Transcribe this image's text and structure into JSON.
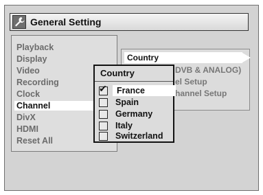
{
  "window": {
    "title": "General Setting",
    "icon": "wrench-icon"
  },
  "leftmenu": {
    "items": [
      "Playback",
      "Display",
      "Video",
      "Recording",
      "Clock",
      "Channel",
      "DivX",
      "HDMI",
      "Reset All"
    ],
    "selected": "Channel"
  },
  "rightmenu": {
    "items": [
      "Country",
      "DVB & ANALOG)",
      "el Setup",
      "hannel Setup"
    ],
    "highlighted": "Country"
  },
  "popup": {
    "title": "Country",
    "options": [
      {
        "label": "France",
        "checked": true
      },
      {
        "label": "Spain",
        "checked": false
      },
      {
        "label": "Germany",
        "checked": false
      },
      {
        "label": "Italy",
        "checked": false
      },
      {
        "label": "Switzerland",
        "checked": false
      }
    ]
  },
  "colors": {
    "background": "#d3d3d3",
    "selected": "#ffffff",
    "text": "#111111",
    "muted": "#6b6b6b"
  }
}
